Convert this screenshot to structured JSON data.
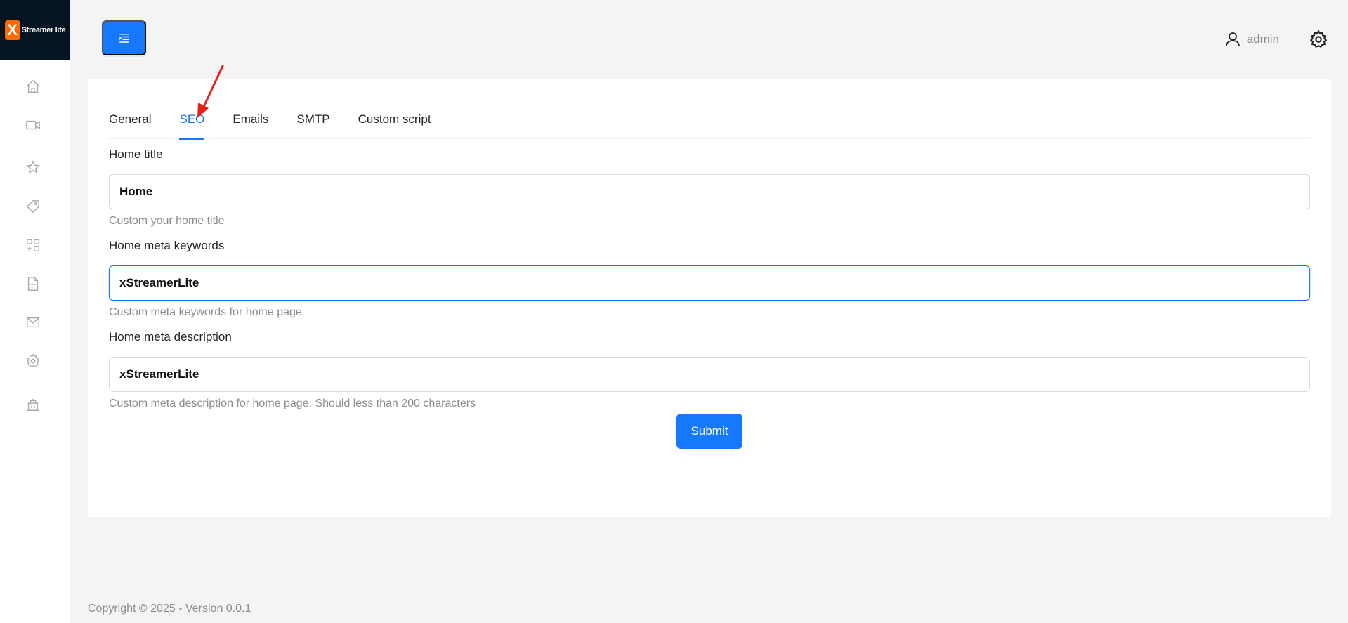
{
  "app": {
    "logo_letter": "X",
    "logo_text": "Streamer lite"
  },
  "sidebar": {
    "items": [
      {
        "icon": "home-icon"
      },
      {
        "icon": "video-icon"
      },
      {
        "icon": "star-icon"
      },
      {
        "icon": "tag-icon"
      },
      {
        "icon": "apps-icon"
      },
      {
        "icon": "file-icon"
      },
      {
        "icon": "mail-icon"
      },
      {
        "icon": "settings-icon"
      },
      {
        "icon": "building-icon"
      }
    ]
  },
  "header": {
    "user_name": "admin"
  },
  "tabs": [
    {
      "label": "General",
      "active": false
    },
    {
      "label": "SEO",
      "active": true
    },
    {
      "label": "Emails",
      "active": false
    },
    {
      "label": "SMTP",
      "active": false
    },
    {
      "label": "Custom script",
      "active": false
    }
  ],
  "form": {
    "home_title": {
      "label": "Home title",
      "value": "Home",
      "help": "Custom your home title"
    },
    "home_meta_keywords": {
      "label": "Home meta keywords",
      "value": "xStreamerLite",
      "help": "Custom meta keywords for home page"
    },
    "home_meta_description": {
      "label": "Home meta description",
      "value": "xStreamerLite",
      "help": "Custom meta description for home page. Should less than 200 characters"
    },
    "submit_label": "Submit"
  },
  "footer": {
    "text": "Copyright © 2025 - Version 0.0.1"
  },
  "colors": {
    "primary": "#1677ff",
    "logo_bg": "#061321",
    "logo_accent": "#ff6a00",
    "annotation_arrow": "#e8201a"
  }
}
